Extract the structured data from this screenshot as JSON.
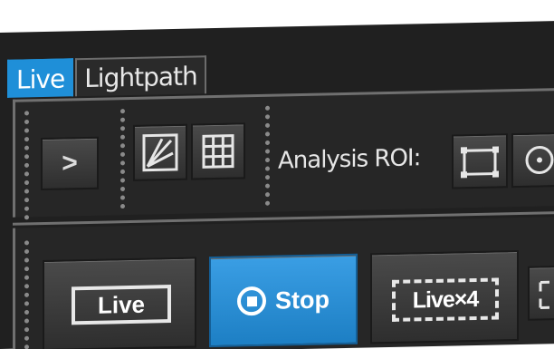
{
  "tabs": [
    {
      "label": "Live",
      "active": true
    },
    {
      "label": "Lightpath",
      "active": false
    }
  ],
  "toolbar": {
    "expand_glyph": ">",
    "analysis_roi_label": "Analysis ROI:"
  },
  "acquisition": {
    "live_label": "Live",
    "stop_label": "Stop",
    "livex4_label": "Live×4"
  },
  "colors": {
    "accent": "#1f8fd8",
    "background": "#202020",
    "button": "#3a3a3a"
  },
  "icons": {
    "expand": "chevron-right-icon",
    "view1": "split-view-icon",
    "view2": "grid-icon",
    "roi_rect": "rectangle-roi-icon",
    "roi_circle": "circle-roi-icon",
    "stop": "stop-icon",
    "snap": "crop-frame-icon"
  }
}
